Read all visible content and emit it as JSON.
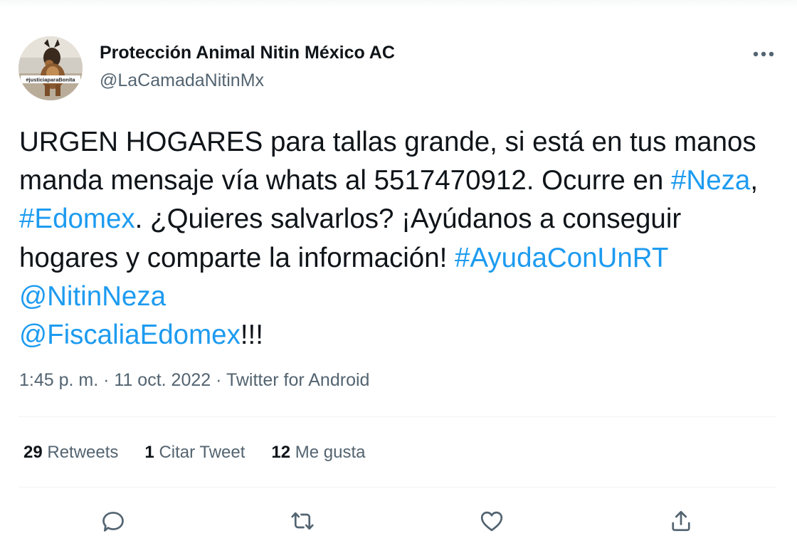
{
  "author": {
    "display_name": "Protección Animal Nitin México AC",
    "handle": "@LaCamadaNitinMx",
    "avatar_badge_text": "#justiciaparaBonita"
  },
  "tweet": {
    "segments": [
      {
        "text": "URGEN HOGARES para tallas grande, si está en tus manos manda mensaje vía whats al 5517470912. Ocurre en ",
        "link": false
      },
      {
        "text": "#Neza",
        "link": true
      },
      {
        "text": ", ",
        "link": false
      },
      {
        "text": "#Edomex",
        "link": true
      },
      {
        "text": ". ¿Quieres salvarlos? ¡Ayúdanos a conseguir hogares y comparte la información! ",
        "link": false
      },
      {
        "text": "#AyudaConUnRT",
        "link": true
      },
      {
        "text": " ",
        "link": false
      },
      {
        "text": "@NitinNeza",
        "link": true
      },
      {
        "text": " ",
        "link": false
      },
      {
        "text": "@FiscaliaEdomex",
        "link": true
      },
      {
        "text": "!!!",
        "link": false
      }
    ]
  },
  "meta": {
    "time": "1:45 p. m.",
    "separator": "·",
    "date": "11 oct. 2022",
    "source": "Twitter for Android"
  },
  "stats": {
    "retweets": {
      "count": "29",
      "label": "Retweets"
    },
    "quotes": {
      "count": "1",
      "label": "Citar Tweet"
    },
    "likes": {
      "count": "12",
      "label": "Me gusta"
    }
  },
  "icons": {
    "more": "more-horizontal-icon",
    "reply": "reply-icon",
    "retweet": "retweet-icon",
    "like": "heart-icon",
    "share": "share-icon"
  },
  "colors": {
    "text": "#0f1419",
    "secondary": "#536471",
    "link": "#1d9bf0",
    "divider": "#eff3f4"
  }
}
